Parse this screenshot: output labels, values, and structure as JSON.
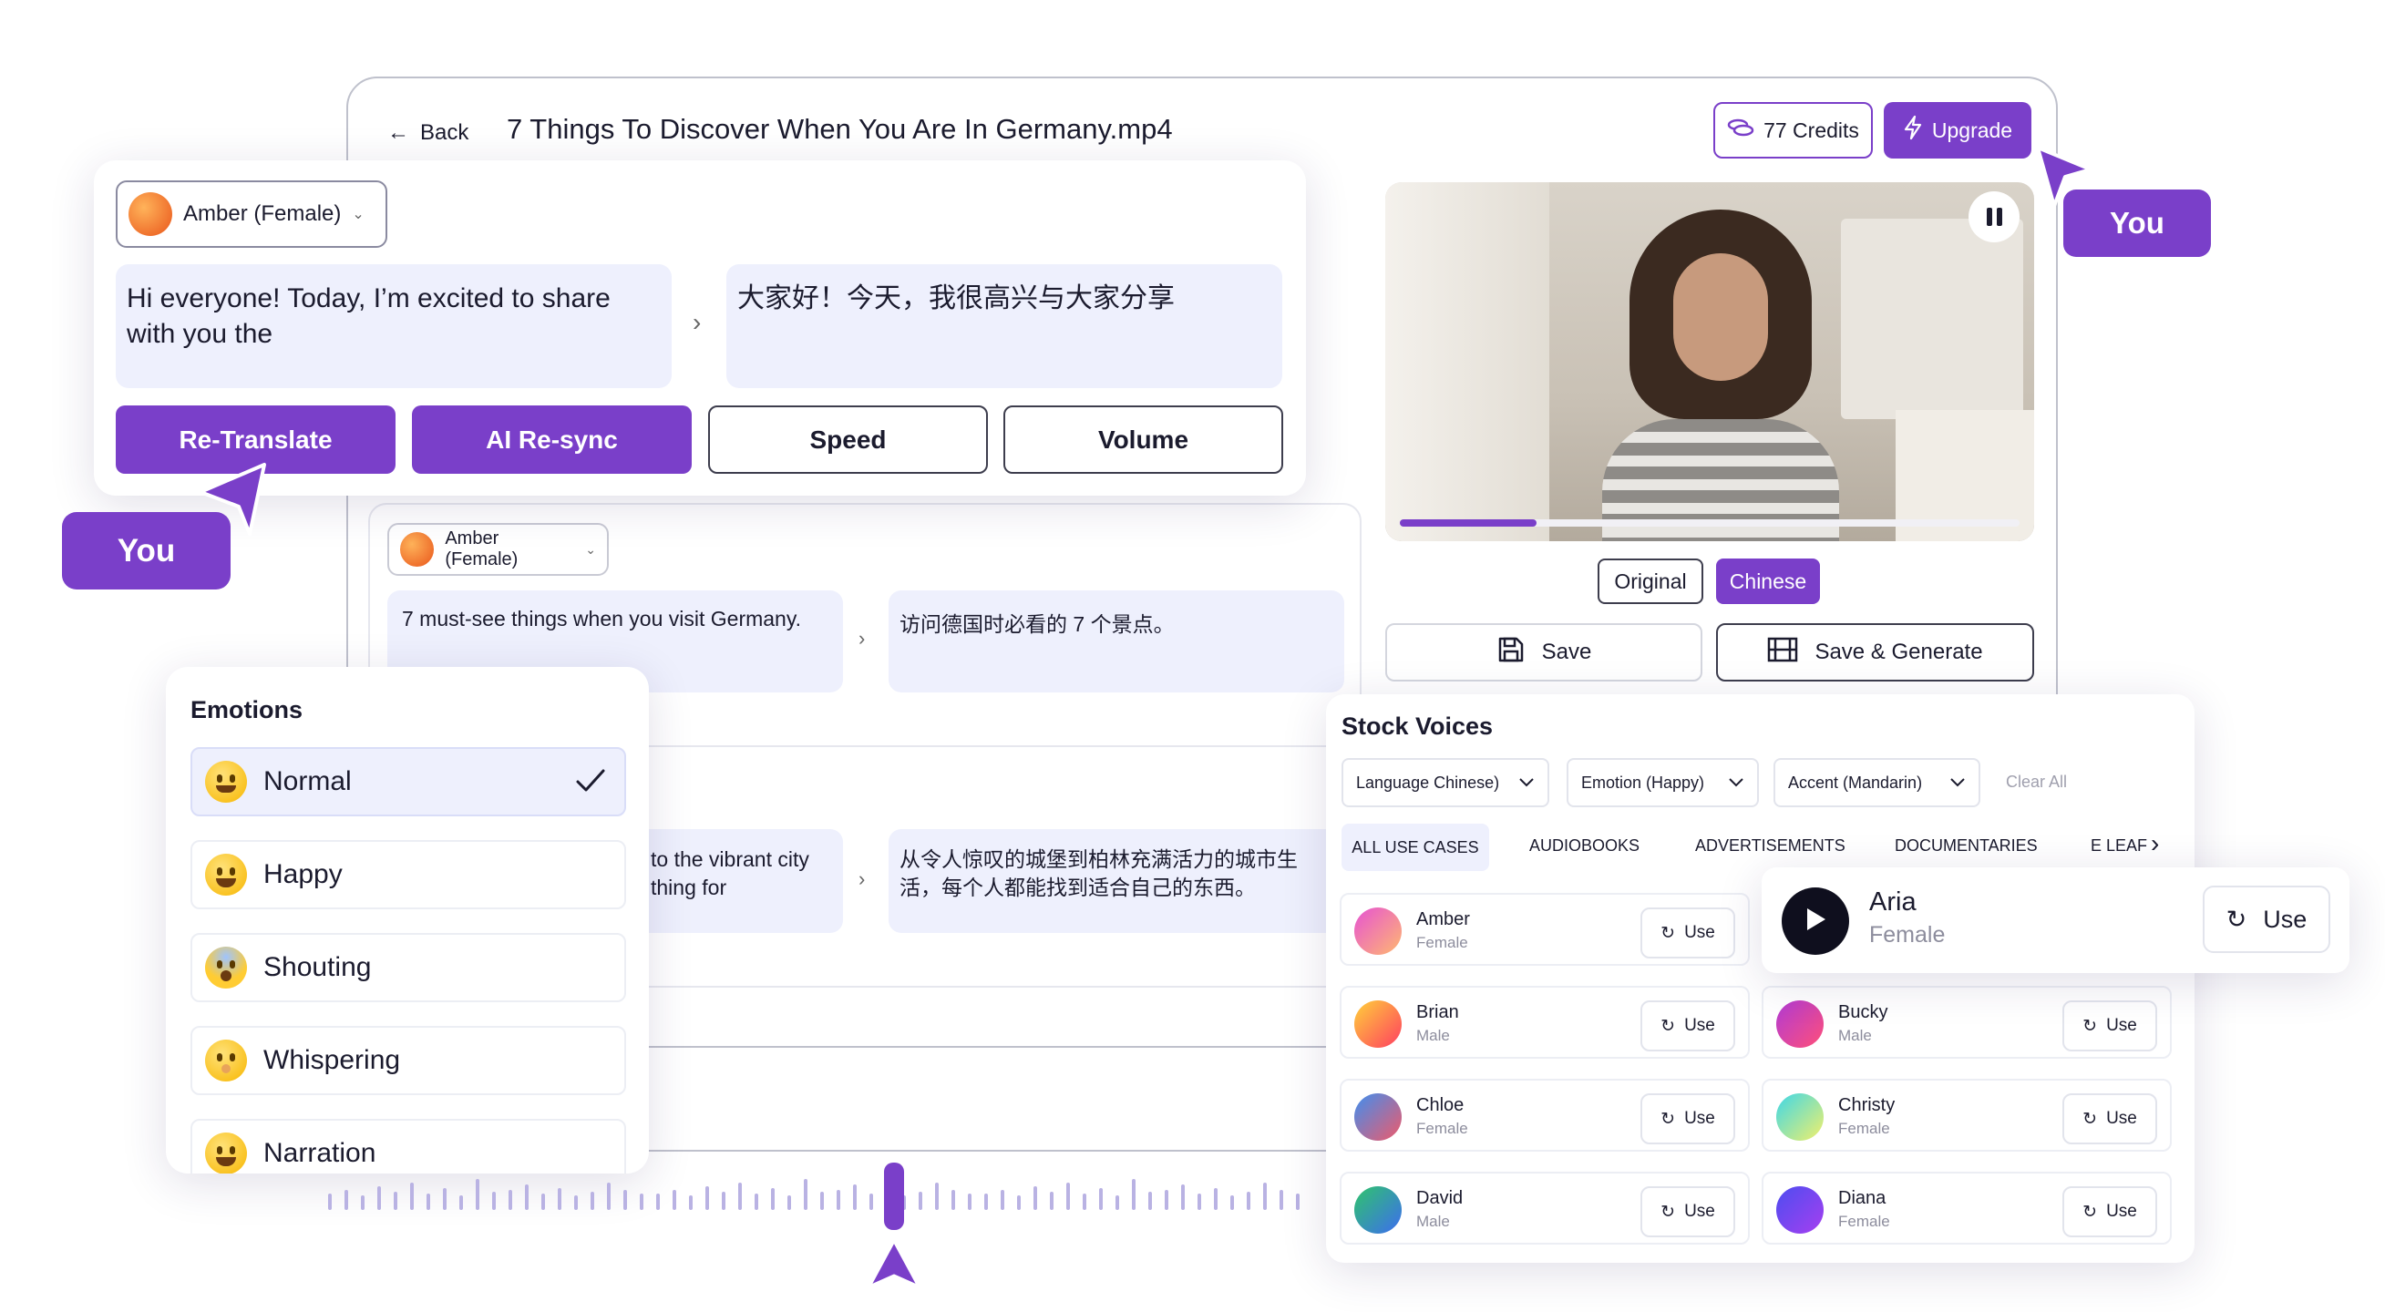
{
  "editor": {
    "back_label": "Back",
    "file_title": "7 Things To Discover When You Are In Germany.mp4",
    "credits_label": "77 Credits",
    "upgrade_label": "Upgrade"
  },
  "cursor_labels": {
    "top_right": "You",
    "left": "You"
  },
  "segment_popup": {
    "voice": "Amber (Female)",
    "source_text": "Hi everyone! Today, I’m excited to share with you the",
    "translated_text": "大家好！今天，我很高兴与大家分享",
    "buttons": [
      "Re-Translate",
      "AI Re-sync",
      "Speed",
      "Volume"
    ]
  },
  "segment_2": {
    "voice": "Amber (Female)",
    "source_text": "7 must-see things when you visit Germany.",
    "translated_text": "访问德国时必看的 7 个景点。"
  },
  "segment_3": {
    "source_line1": "to the vibrant city",
    "source_line2": "thing for",
    "translated_text": "从令人惊叹的城堡到柏林充满活力的城市生活，每个人都能找到适合自己的东西。"
  },
  "player": {
    "progress": 0.22,
    "lang_original": "Original",
    "lang_chinese": "Chinese",
    "save_label": "Save",
    "save_generate_label": "Save & Generate"
  },
  "emotions": {
    "title": "Emotions",
    "items": [
      "Normal",
      "Happy",
      "Shouting",
      "Whispering",
      "Narration"
    ],
    "selected": "Normal"
  },
  "stock_voices": {
    "title": "Stock Voices",
    "filters": [
      "Language Chinese)",
      "Emotion (Happy)",
      "Accent (Mandarin)"
    ],
    "clear_all": "Clear All",
    "tabs": [
      "ALL USE CASES",
      "AUDIOBOOKS",
      "ADVERTISEMENTS",
      "DOCUMENTARIES",
      "E LEAF"
    ],
    "use_label": "Use",
    "voices": [
      {
        "name": "Amber",
        "gender": "Female"
      },
      {
        "name": "Brian",
        "gender": "Male"
      },
      {
        "name": "Bucky",
        "gender": "Male"
      },
      {
        "name": "Chloe",
        "gender": "Female"
      },
      {
        "name": "Christy",
        "gender": "Female"
      },
      {
        "name": "David",
        "gender": "Male"
      },
      {
        "name": "Diana",
        "gender": "Female"
      }
    ],
    "highlight": {
      "name": "Aria",
      "gender": "Female",
      "use": "Use"
    }
  },
  "colors": {
    "accent": "#7a3fc9",
    "bubble": "#eef0fd",
    "text": "#1b1b2e"
  }
}
